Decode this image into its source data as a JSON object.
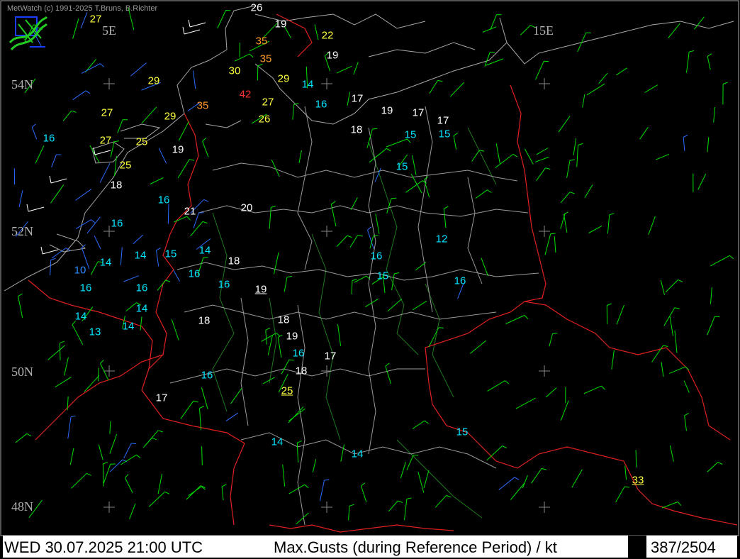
{
  "header": {
    "credit": "MetWatch  (c) 1991-2025 T.Bruns, B.Richter"
  },
  "status_bar": {
    "datetime": "WED 30.07.2025 21:00 UTC",
    "parameter": "Max.Gusts (during Reference Period) / kt",
    "count": "387/2504"
  },
  "grid_labels": {
    "longitudes": [
      "5E",
      "15E"
    ],
    "latitudes": [
      "54N",
      "52N",
      "50N",
      "48N"
    ]
  },
  "colors": {
    "white": "#ffffff",
    "cyan": "#00e5ff",
    "yellow": "#ffff40",
    "orange": "#ff9a2a",
    "red": "#ff3030",
    "blue": "#2a8cff",
    "border": "#e02020",
    "coast": "#a0a0a0",
    "wind_green": "#00e000",
    "wind_blue": "#2a6cff"
  },
  "stations": [
    {
      "v": "26",
      "c": "white"
    },
    {
      "v": "19",
      "c": "white"
    },
    {
      "v": "27",
      "c": "yellow"
    },
    {
      "v": "35",
      "c": "orange"
    },
    {
      "v": "22",
      "c": "yellow"
    },
    {
      "v": "35",
      "c": "orange"
    },
    {
      "v": "19",
      "c": "white"
    },
    {
      "v": "30",
      "c": "yellow"
    },
    {
      "v": "29",
      "c": "yellow"
    },
    {
      "v": "29",
      "c": "yellow"
    },
    {
      "v": "14",
      "c": "cyan"
    },
    {
      "v": "42",
      "c": "red"
    },
    {
      "v": "27",
      "c": "yellow"
    },
    {
      "v": "17",
      "c": "white"
    },
    {
      "v": "35",
      "c": "orange"
    },
    {
      "v": "16",
      "c": "cyan"
    },
    {
      "v": "27",
      "c": "yellow"
    },
    {
      "v": "29",
      "c": "yellow"
    },
    {
      "v": "26",
      "c": "yellow"
    },
    {
      "v": "19",
      "c": "white"
    },
    {
      "v": "17",
      "c": "white"
    },
    {
      "v": "17",
      "c": "white"
    },
    {
      "v": "18",
      "c": "white"
    },
    {
      "v": "15",
      "c": "cyan"
    },
    {
      "v": "15",
      "c": "cyan"
    },
    {
      "v": "16",
      "c": "cyan"
    },
    {
      "v": "27",
      "c": "yellow"
    },
    {
      "v": "25",
      "c": "yellow"
    },
    {
      "v": "19",
      "c": "white"
    },
    {
      "v": "25",
      "c": "yellow"
    },
    {
      "v": "15",
      "c": "cyan"
    },
    {
      "v": "18",
      "c": "white"
    },
    {
      "v": "16",
      "c": "cyan"
    },
    {
      "v": "20",
      "c": "white"
    },
    {
      "v": "21",
      "c": "white"
    },
    {
      "v": "16",
      "c": "cyan"
    },
    {
      "v": "12",
      "c": "cyan"
    },
    {
      "v": "14",
      "c": "cyan"
    },
    {
      "v": "15",
      "c": "cyan"
    },
    {
      "v": "14",
      "c": "cyan"
    },
    {
      "v": "18",
      "c": "white"
    },
    {
      "v": "16",
      "c": "cyan"
    },
    {
      "v": "14",
      "c": "cyan"
    },
    {
      "v": "10",
      "c": "blue"
    },
    {
      "v": "16",
      "c": "cyan"
    },
    {
      "v": "15",
      "c": "cyan"
    },
    {
      "v": "16",
      "c": "cyan"
    },
    {
      "v": "16",
      "c": "cyan"
    },
    {
      "v": "19",
      "c": "white",
      "u": true
    },
    {
      "v": "16",
      "c": "cyan"
    },
    {
      "v": "16",
      "c": "cyan"
    },
    {
      "v": "14",
      "c": "cyan"
    },
    {
      "v": "18",
      "c": "white"
    },
    {
      "v": "18",
      "c": "white"
    },
    {
      "v": "14",
      "c": "cyan"
    },
    {
      "v": "14",
      "c": "cyan"
    },
    {
      "v": "19",
      "c": "white"
    },
    {
      "v": "13",
      "c": "cyan"
    },
    {
      "v": "16",
      "c": "cyan"
    },
    {
      "v": "17",
      "c": "white"
    },
    {
      "v": "16",
      "c": "cyan"
    },
    {
      "v": "18",
      "c": "white"
    },
    {
      "v": "17",
      "c": "white"
    },
    {
      "v": "25",
      "c": "yellow",
      "u": true
    },
    {
      "v": "15",
      "c": "cyan"
    },
    {
      "v": "14",
      "c": "cyan"
    },
    {
      "v": "14",
      "c": "cyan"
    },
    {
      "v": "33",
      "c": "yellow",
      "u": true
    }
  ]
}
